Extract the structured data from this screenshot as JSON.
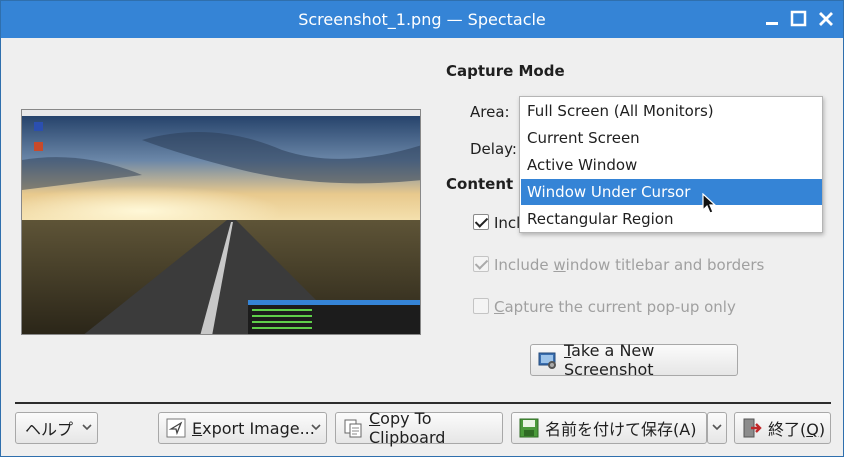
{
  "window": {
    "title": "Screenshot_1.png — Spectacle",
    "controls": [
      "minimize-icon",
      "maximize-icon",
      "close-icon"
    ],
    "accent_color": "#3584d6"
  },
  "capture_mode": {
    "heading": "Capture Mode",
    "area_label": "Area:",
    "delay_label": "Delay:",
    "area_options": [
      "Full Screen (All Monitors)",
      "Current Screen",
      "Active Window",
      "Window Under Cursor",
      "Rectangular Region"
    ],
    "highlighted_option": "Window Under Cursor"
  },
  "content_options": {
    "heading_visible": "Content O",
    "include_pointer_visible": "Incl",
    "include_pointer_checked": true,
    "titlebar_label_pre": "Include ",
    "titlebar_label_ul": "w",
    "titlebar_label_post": "indow titlebar and borders",
    "titlebar_checked": true,
    "titlebar_disabled": true,
    "popup_label_ul": "C",
    "popup_label_post": "apture the current pop-up only",
    "popup_checked": false,
    "popup_disabled": true
  },
  "take_button": {
    "label_ul": "T",
    "label_post": "ake a New Screenshot",
    "icon": "camera-icon"
  },
  "bottom_bar": {
    "help": "ヘルプ",
    "export_ul": "E",
    "export_post": "xport Image...",
    "copy_ul": "C",
    "copy_post": "opy To Clipboard",
    "save": "名前を付けて保存(A)",
    "quit_pre": "終了(",
    "quit_ul": "Q",
    "quit_post": ")"
  },
  "preview": {
    "icon": "desktop-screenshot-thumbnail"
  }
}
